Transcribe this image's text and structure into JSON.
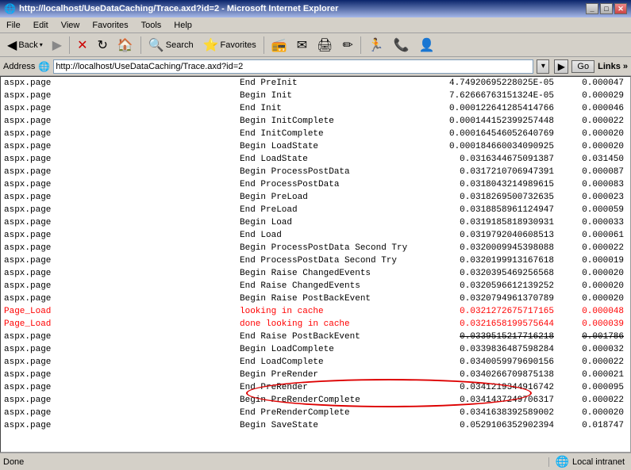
{
  "titleBar": {
    "icon": "🌐",
    "title": "http://localhost/UseDataCaching/Trace.axd?id=2 - Microsoft Internet Explorer",
    "buttons": [
      "_",
      "□",
      "✕"
    ]
  },
  "menuBar": {
    "items": [
      "File",
      "Edit",
      "View",
      "Favorites",
      "Tools",
      "Help"
    ]
  },
  "toolbar": {
    "back_label": "Back",
    "search_label": "Search",
    "favorites_label": "Favorites"
  },
  "addressBar": {
    "label": "Address",
    "url": "http://localhost/UseDataCaching/Trace.axd?id=2",
    "go_label": "Go",
    "links_label": "Links"
  },
  "table": {
    "rows": [
      {
        "category": "aspx.page",
        "message": "End PreInit",
        "time": "4.74920695228025E-05",
        "first": "0.000047",
        "highlight": false
      },
      {
        "category": "aspx.page",
        "message": "Begin Init",
        "time": "7.62666763151324E-05",
        "first": "0.000029",
        "highlight": false
      },
      {
        "category": "aspx.page",
        "message": "End Init",
        "time": "0.000122641285414766",
        "first": "0.000046",
        "highlight": false
      },
      {
        "category": "aspx.page",
        "message": "Begin InitComplete",
        "time": "0.000144152399257448",
        "first": "0.000022",
        "highlight": false
      },
      {
        "category": "aspx.page",
        "message": "End InitComplete",
        "time": "0.000164546052640769",
        "first": "0.000020",
        "highlight": false
      },
      {
        "category": "aspx.page",
        "message": "Begin LoadState",
        "time": "0.000184660034090925",
        "first": "0.000020",
        "highlight": false
      },
      {
        "category": "aspx.page",
        "message": "End LoadState",
        "time": "0.0316344675091387",
        "first": "0.031450",
        "highlight": false
      },
      {
        "category": "aspx.page",
        "message": "Begin ProcessPostData",
        "time": "0.0317210706947391",
        "first": "0.000087",
        "highlight": false
      },
      {
        "category": "aspx.page",
        "message": "End ProcessPostData",
        "time": "0.0318043214989615",
        "first": "0.000083",
        "highlight": false
      },
      {
        "category": "aspx.page",
        "message": "Begin PreLoad",
        "time": "0.0318269500732635",
        "first": "0.000023",
        "highlight": false
      },
      {
        "category": "aspx.page",
        "message": "End PreLoad",
        "time": "0.0318858961124947",
        "first": "0.000059",
        "highlight": false
      },
      {
        "category": "aspx.page",
        "message": "Begin Load",
        "time": "0.0319185818930931",
        "first": "0.000033",
        "highlight": false
      },
      {
        "category": "aspx.page",
        "message": "End Load",
        "time": "0.0319792040608513",
        "first": "0.000061",
        "highlight": false
      },
      {
        "category": "aspx.page",
        "message": "Begin ProcessPostData Second Try",
        "time": "0.0320009945398088",
        "first": "0.000022",
        "highlight": false
      },
      {
        "category": "aspx.page",
        "message": "End ProcessPostData Second Try",
        "time": "0.0320199913167618",
        "first": "0.000019",
        "highlight": false
      },
      {
        "category": "aspx.page",
        "message": "Begin Raise ChangedEvents",
        "time": "0.0320395469256568",
        "first": "0.000020",
        "highlight": false
      },
      {
        "category": "aspx.page",
        "message": "End Raise ChangedEvents",
        "time": "0.0320596612139252",
        "first": "0.000020",
        "highlight": false
      },
      {
        "category": "aspx.page",
        "message": "Begin Raise PostBackEvent",
        "time": "0.0320794961370789",
        "first": "0.000020",
        "highlight": false
      },
      {
        "category": "Page_Load",
        "message": "looking in cache",
        "time": "0.0321272675717165",
        "first": "0.000048",
        "highlight": true
      },
      {
        "category": "Page_Load",
        "message": "done looking in cache",
        "time": "0.0321658199575644",
        "first": "0.000039",
        "highlight": true
      },
      {
        "category": "aspx.page",
        "message": "End Raise PostBackEvent",
        "time": "0.0339515217716218",
        "first": "0.001786",
        "highlight": false,
        "strikethrough": true
      },
      {
        "category": "aspx.page",
        "message": "Begin LoadComplete",
        "time": "0.0339836487598284",
        "first": "0.000032",
        "highlight": false
      },
      {
        "category": "aspx.page",
        "message": "End LoadComplete",
        "time": "0.0340059979690156",
        "first": "0.000022",
        "highlight": false
      },
      {
        "category": "aspx.page",
        "message": "Begin PreRender",
        "time": "0.0340266709875138",
        "first": "0.000021",
        "highlight": false
      },
      {
        "category": "aspx.page",
        "message": "End PreRender",
        "time": "0.0341219344916742",
        "first": "0.000095",
        "highlight": false
      },
      {
        "category": "aspx.page",
        "message": "Begin PreRenderComplete",
        "time": "0.0341437249706317",
        "first": "0.000022",
        "highlight": false
      },
      {
        "category": "aspx.page",
        "message": "End PreRenderComplete",
        "time": "0.0341638392589002",
        "first": "0.000020",
        "highlight": false
      },
      {
        "category": "aspx.page",
        "message": "Begin SaveState",
        "time": "0.0529106352902394",
        "first": "0.018747",
        "highlight": false
      }
    ]
  },
  "statusBar": {
    "left": "Done",
    "right": "Local intranet"
  }
}
